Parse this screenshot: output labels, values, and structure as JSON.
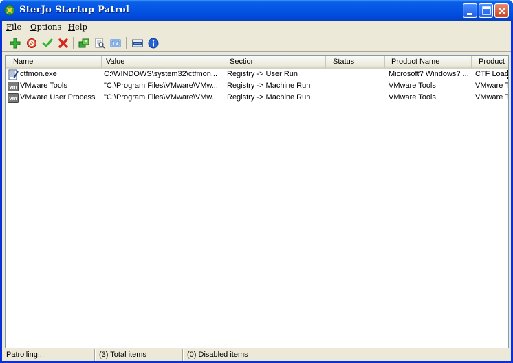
{
  "window": {
    "title": "SterJo Startup Patrol"
  },
  "menu": {
    "items": [
      {
        "label": "File"
      },
      {
        "label": "Options"
      },
      {
        "label": "Help"
      }
    ]
  },
  "toolbar": {
    "buttons": [
      {
        "icon": "add-icon",
        "color": "#2aa52a"
      },
      {
        "icon": "disable-icon",
        "color": "#d6341c"
      },
      {
        "icon": "enable-check-icon",
        "color": "#2fb52f"
      },
      {
        "icon": "delete-x-icon",
        "color": "#d6281c"
      },
      {
        "icon": "refresh-icon",
        "color": "#2aa52a"
      },
      {
        "icon": "search-file-icon",
        "color": "#7a8aa0"
      },
      {
        "icon": "properties-icon",
        "color": "#2f7ad6"
      },
      {
        "icon": "paypal-donate-icon",
        "color": "#1c4e9e"
      },
      {
        "icon": "info-icon",
        "color": "#1c59c8"
      }
    ]
  },
  "list": {
    "columns": [
      {
        "label": "Name"
      },
      {
        "label": "Value"
      },
      {
        "label": "Section"
      },
      {
        "label": "Status"
      },
      {
        "label": "Product Name"
      },
      {
        "label": "Product"
      }
    ],
    "rows": [
      {
        "icon": "exe-file-icon",
        "name": "ctfmon.exe",
        "value": "C:\\WINDOWS\\system32\\ctfmon...",
        "section": "Registry -> User Run",
        "status": "",
        "product_name": "Microsoft? Windows? ...",
        "product": "CTF Load"
      },
      {
        "icon": "vmware-icon",
        "name": "VMware Tools",
        "value": "\"C:\\Program Files\\VMware\\VMw...",
        "section": "Registry -> Machine Run",
        "status": "",
        "product_name": "VMware Tools",
        "product": "VMware T"
      },
      {
        "icon": "vmware-icon",
        "name": "VMware User Process",
        "value": "\"C:\\Program Files\\VMware\\VMw...",
        "section": "Registry -> Machine Run",
        "status": "",
        "product_name": "VMware Tools",
        "product": "VMware T"
      }
    ]
  },
  "statusbar": {
    "state": "Patrolling...",
    "total": "(3) Total items",
    "disabled": "(0) Disabled items"
  }
}
